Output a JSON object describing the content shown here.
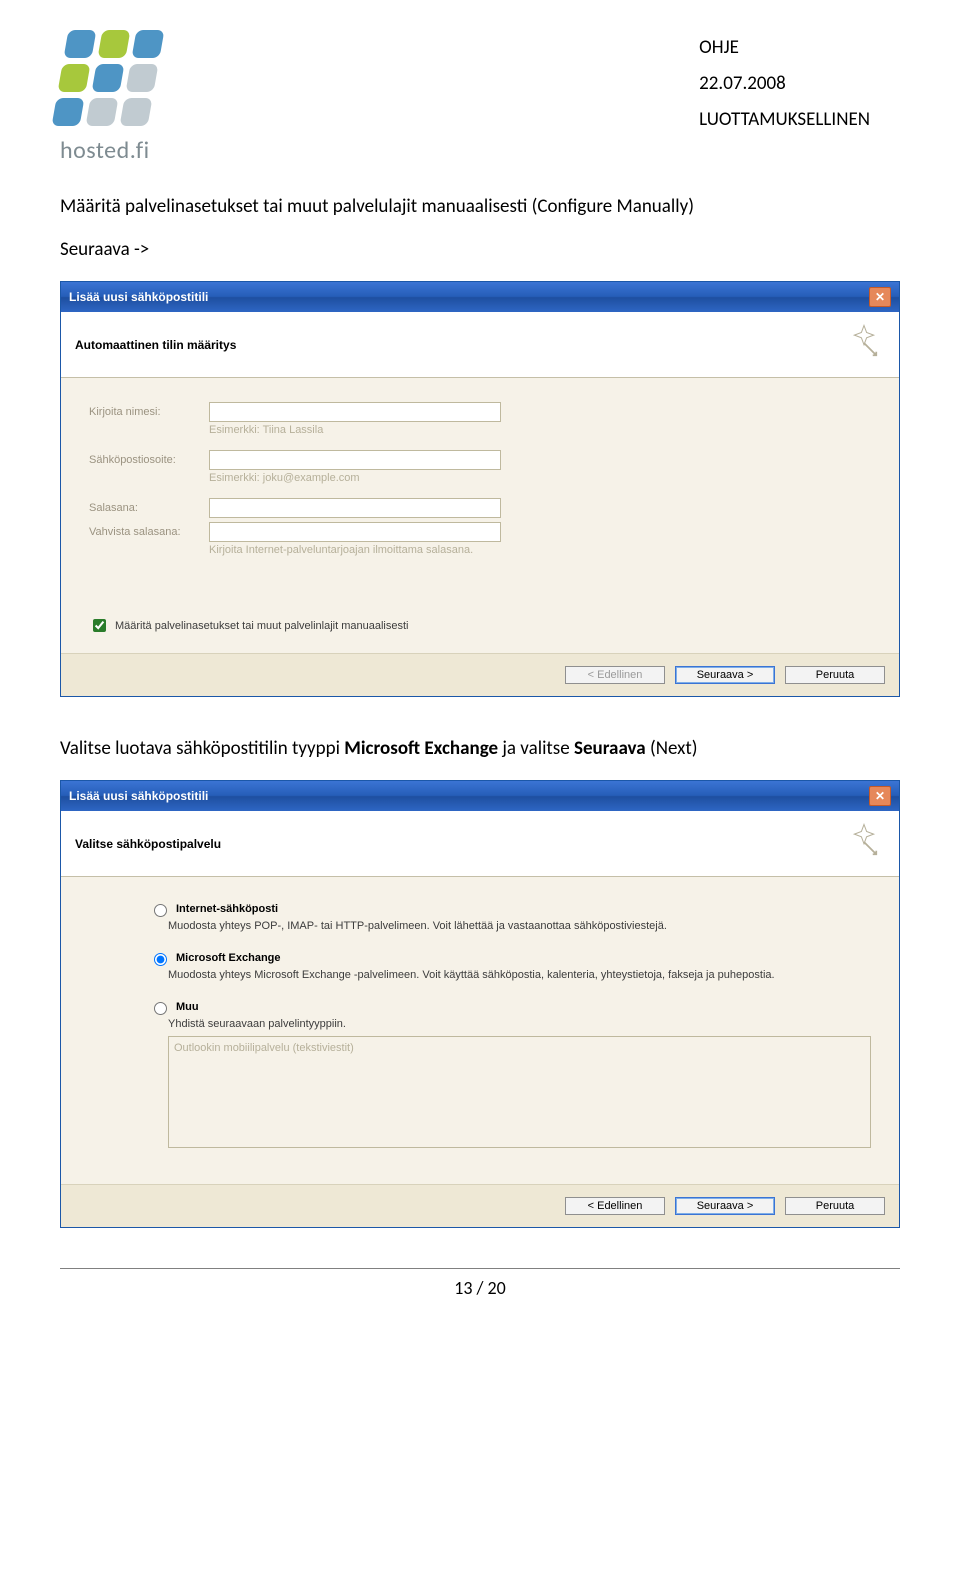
{
  "header": {
    "line1": "OHJE",
    "line2": "22.07.2008",
    "line3": "LUOTTAMUKSELLINEN"
  },
  "logo_text": "hosted.fi",
  "para1": "Määritä palvelinasetukset tai muut palvelulajit manuaalisesti (Configure Manually)",
  "para2": "Seuraava ->",
  "para3_a": "Valitse luotava sähköpostitilin tyyppi ",
  "para3_b": "Microsoft Exchange",
  "para3_c": " ja valitse ",
  "para3_d": "Seuraava",
  "para3_e": " (Next)",
  "dlg1": {
    "title": "Lisää uusi sähköpostitili",
    "head": "Automaattinen tilin määritys",
    "labels": {
      "name": "Kirjoita nimesi:",
      "email": "Sähköpostiosoite:",
      "pass": "Salasana:",
      "pass2": "Vahvista salasana:"
    },
    "hints": {
      "name": "Esimerkki: Tiina Lassila",
      "email": "Esimerkki: joku@example.com",
      "pass": "Kirjoita Internet-palveluntarjoajan ilmoittama salasana."
    },
    "check": "Määritä palvelinasetukset tai muut palvelinlajit manuaalisesti",
    "btn_back": "< Edellinen",
    "btn_next": "Seuraava >",
    "btn_cancel": "Peruuta"
  },
  "dlg2": {
    "title": "Lisää uusi sähköpostitili",
    "head": "Valitse sähköpostipalvelu",
    "opt1": {
      "label": "Internet-sähköposti",
      "desc": "Muodosta yhteys POP-, IMAP- tai HTTP-palvelimeen. Voit lähettää ja vastaanottaa sähköpostiviestejä."
    },
    "opt2": {
      "label": "Microsoft Exchange",
      "desc": "Muodosta yhteys Microsoft Exchange -palvelimeen. Voit käyttää sähköpostia, kalenteria, yhteystietoja, fakseja ja puhepostia."
    },
    "opt3": {
      "label": "Muu",
      "desc": "Yhdistä seuraavaan palvelintyyppiin.",
      "list": "Outlookin mobiilipalvelu (tekstiviestit)"
    },
    "btn_back": "< Edellinen",
    "btn_next": "Seuraava >",
    "btn_cancel": "Peruuta"
  },
  "footer": "13 / 20"
}
